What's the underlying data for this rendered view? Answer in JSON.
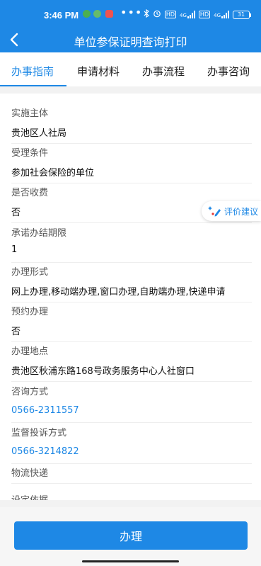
{
  "status_bar": {
    "time": "3:46 PM",
    "more": "•••",
    "battery": "31",
    "net_hd": "HD",
    "net_4g": "4G"
  },
  "nav": {
    "title": "单位参保证明查询打印"
  },
  "tabs": [
    {
      "label": "办事指南",
      "active": true
    },
    {
      "label": "申请材料",
      "active": false
    },
    {
      "label": "办事流程",
      "active": false
    },
    {
      "label": "办事咨询",
      "active": false
    }
  ],
  "fields": [
    {
      "label": "实施主体",
      "value": "贵池区人社局"
    },
    {
      "label": "受理条件",
      "value": "参加社会保险的单位"
    },
    {
      "label": "是否收费",
      "value": "否"
    },
    {
      "label": "承诺办结期限",
      "value": "1"
    },
    {
      "label": "办理形式",
      "value": "网上办理,移动端办理,窗口办理,自助端办理,快递申请"
    },
    {
      "label": "预约办理",
      "value": "否"
    },
    {
      "label": "办理地点",
      "value": "贵池区秋浦东路168号政务服务中心人社窗口"
    },
    {
      "label": "咨询方式",
      "value": "0566-2311557"
    },
    {
      "label": "监督投诉方式",
      "value": "0566-3214822"
    },
    {
      "label": "物流快递",
      "value": ""
    },
    {
      "label": "设定依据",
      "value": ""
    }
  ],
  "eval_button": {
    "label": "评价建议"
  },
  "submit_button": {
    "label": "办理"
  },
  "colors": {
    "primary": "#1e88e5",
    "background": "#ffffff",
    "gray_band": "#f2f2f2"
  },
  "icons": {
    "back": "chevron-left-icon",
    "eval": "edit-sparkle-icon"
  }
}
